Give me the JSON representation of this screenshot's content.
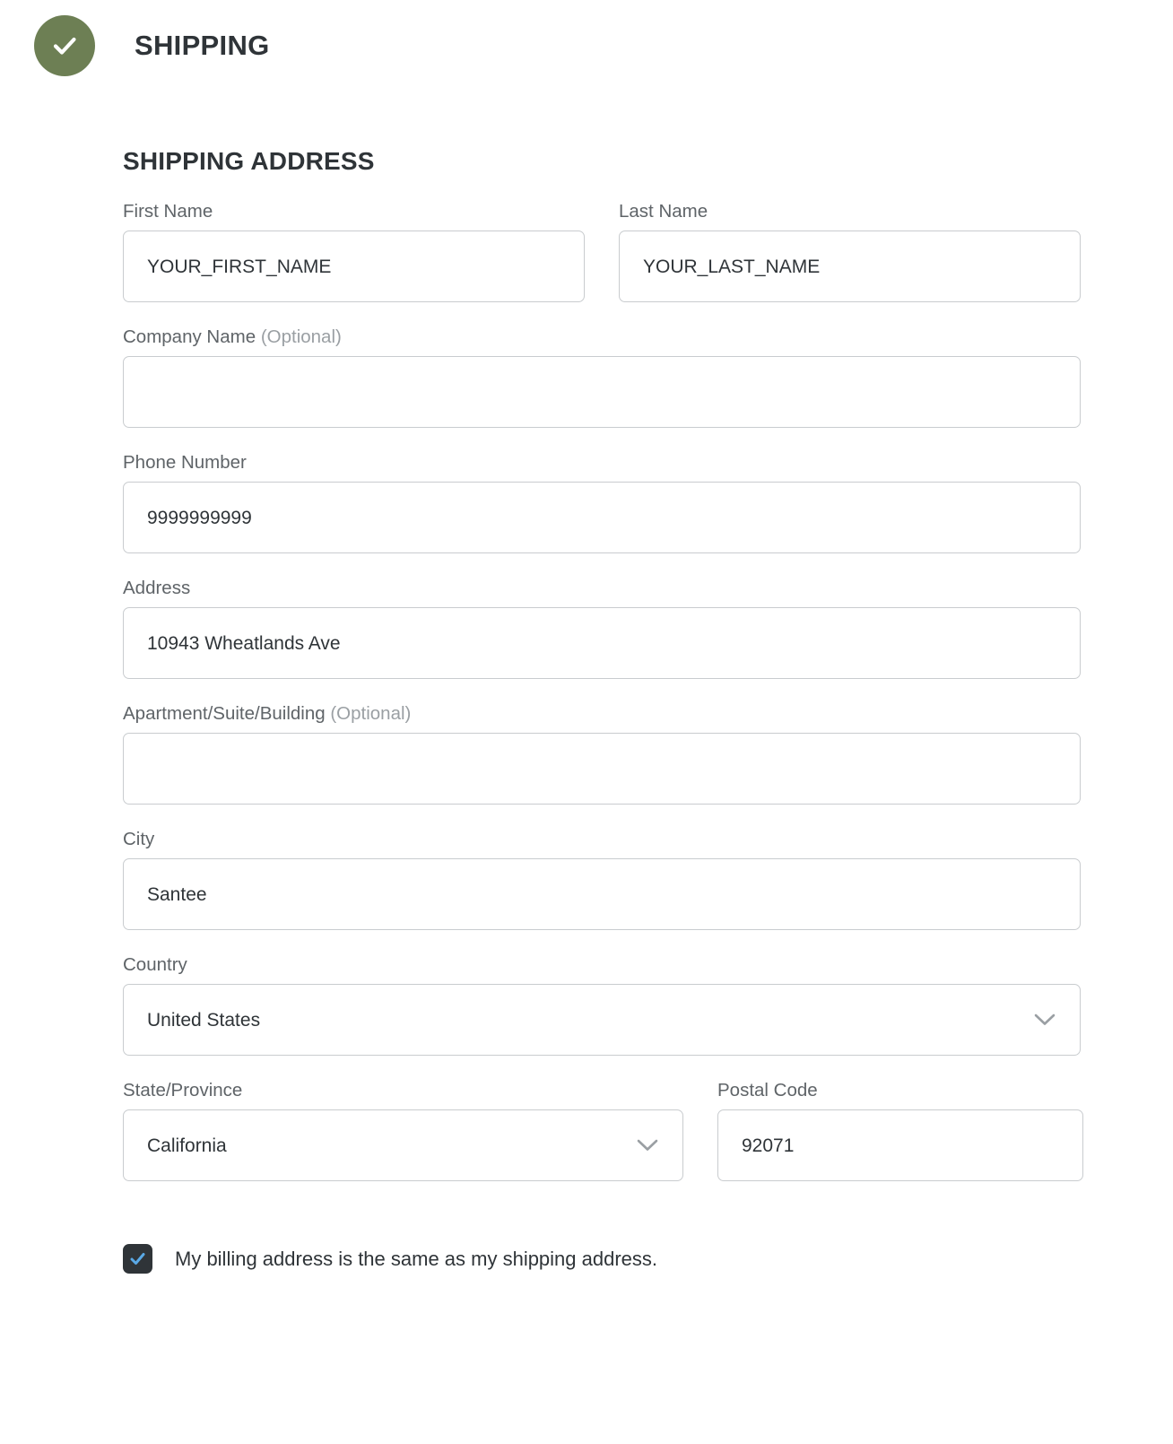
{
  "step": {
    "status_icon": "check-circle-icon",
    "status_color": "#6d7f54",
    "title": "SHIPPING"
  },
  "section": {
    "title": "SHIPPING ADDRESS"
  },
  "fields": {
    "first_name": {
      "label": "First Name",
      "value": "YOUR_FIRST_NAME",
      "placeholder": ""
    },
    "last_name": {
      "label": "Last Name",
      "value": "YOUR_LAST_NAME",
      "placeholder": ""
    },
    "company_name": {
      "label": "Company Name",
      "optional": "(Optional)",
      "value": "",
      "placeholder": ""
    },
    "phone_number": {
      "label": "Phone Number",
      "value": "9999999999",
      "placeholder": ""
    },
    "address": {
      "label": "Address",
      "value": "10943 Wheatlands Ave",
      "placeholder": ""
    },
    "apartment": {
      "label": "Apartment/Suite/Building",
      "optional": "(Optional)",
      "value": "",
      "placeholder": ""
    },
    "city": {
      "label": "City",
      "value": "Santee",
      "placeholder": ""
    },
    "country": {
      "label": "Country",
      "value": "United States",
      "icon": "chevron-down-icon"
    },
    "state_province": {
      "label": "State/Province",
      "value": "California",
      "icon": "chevron-down-icon"
    },
    "postal_code": {
      "label": "Postal Code",
      "value": "92071",
      "placeholder": ""
    }
  },
  "billing_checkbox": {
    "checked": true,
    "icon": "check-icon",
    "check_color": "#5aa9e6",
    "box_color": "#2f3438",
    "label": "My billing address is the same as my shipping address."
  }
}
